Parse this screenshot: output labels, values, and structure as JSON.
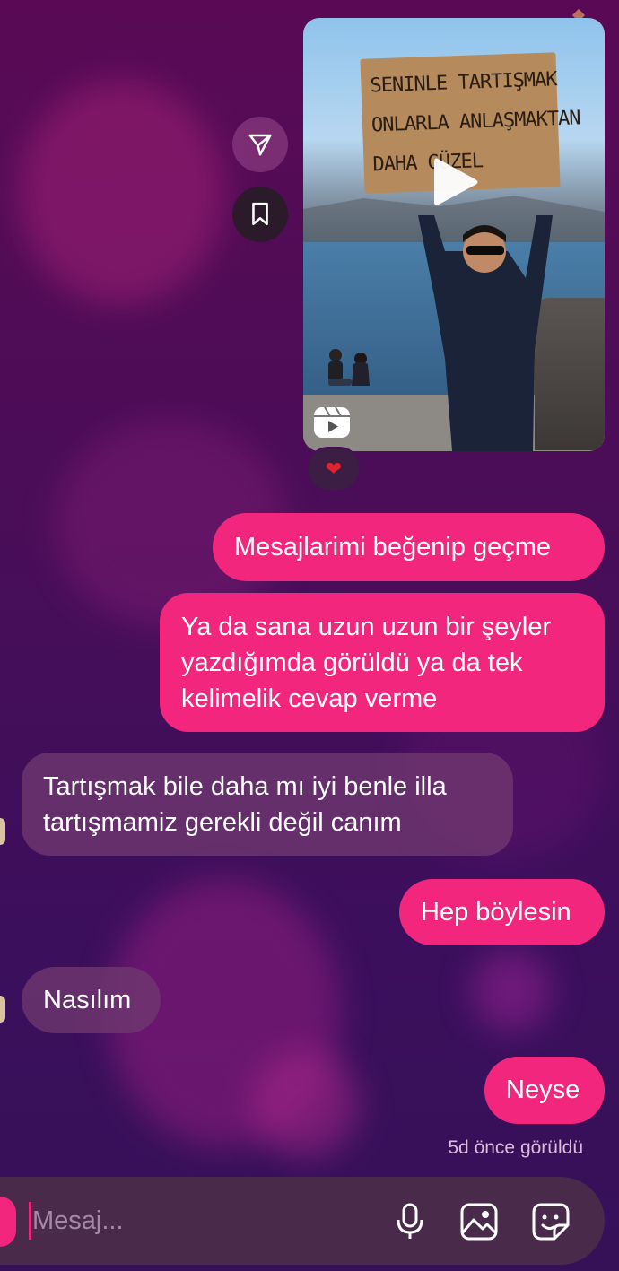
{
  "reel": {
    "sign_lines": [
      "SENINLE TARTIŞMAK",
      "ONLARLA ANLAŞMAKTAN",
      "DAHA GÜZEL"
    ],
    "reaction": "❤"
  },
  "messages": [
    {
      "direction": "outgoing",
      "text": "Mesajlarimi beğenip geçme"
    },
    {
      "direction": "outgoing",
      "text": "Ya da sana uzun uzun bir şeyler yazdığımda görüldü ya da tek kelimelik cevap verme"
    },
    {
      "direction": "incoming",
      "text": "Tartışmak bile daha mı iyi benle illa tartışmamiz gerekli değil canım"
    },
    {
      "direction": "outgoing",
      "text": "Hep böylesin"
    },
    {
      "direction": "incoming",
      "text": "Nasılım"
    },
    {
      "direction": "outgoing",
      "text": "Neyse"
    }
  ],
  "seen_status": "5d önce görüldü",
  "composer": {
    "placeholder": "Mesaj..."
  },
  "icons": [
    "send-icon",
    "bookmark-icon",
    "play-icon",
    "reels-icon",
    "heart-reaction-icon",
    "camera-icon",
    "microphone-icon",
    "gallery-icon",
    "sticker-icon"
  ],
  "colors": {
    "outgoing_bubble": "#f3267e",
    "incoming_bubble": "#703870",
    "background_top": "#5a0a55",
    "background_bottom": "#361158"
  }
}
